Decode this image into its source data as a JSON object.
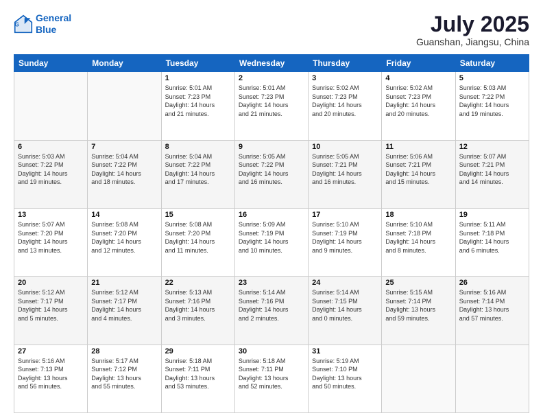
{
  "header": {
    "logo_line1": "General",
    "logo_line2": "Blue",
    "month": "July 2025",
    "location": "Guanshan, Jiangsu, China"
  },
  "weekdays": [
    "Sunday",
    "Monday",
    "Tuesday",
    "Wednesday",
    "Thursday",
    "Friday",
    "Saturday"
  ],
  "weeks": [
    [
      {
        "day": "",
        "info": ""
      },
      {
        "day": "",
        "info": ""
      },
      {
        "day": "1",
        "info": "Sunrise: 5:01 AM\nSunset: 7:23 PM\nDaylight: 14 hours\nand 21 minutes."
      },
      {
        "day": "2",
        "info": "Sunrise: 5:01 AM\nSunset: 7:23 PM\nDaylight: 14 hours\nand 21 minutes."
      },
      {
        "day": "3",
        "info": "Sunrise: 5:02 AM\nSunset: 7:23 PM\nDaylight: 14 hours\nand 20 minutes."
      },
      {
        "day": "4",
        "info": "Sunrise: 5:02 AM\nSunset: 7:23 PM\nDaylight: 14 hours\nand 20 minutes."
      },
      {
        "day": "5",
        "info": "Sunrise: 5:03 AM\nSunset: 7:22 PM\nDaylight: 14 hours\nand 19 minutes."
      }
    ],
    [
      {
        "day": "6",
        "info": "Sunrise: 5:03 AM\nSunset: 7:22 PM\nDaylight: 14 hours\nand 19 minutes."
      },
      {
        "day": "7",
        "info": "Sunrise: 5:04 AM\nSunset: 7:22 PM\nDaylight: 14 hours\nand 18 minutes."
      },
      {
        "day": "8",
        "info": "Sunrise: 5:04 AM\nSunset: 7:22 PM\nDaylight: 14 hours\nand 17 minutes."
      },
      {
        "day": "9",
        "info": "Sunrise: 5:05 AM\nSunset: 7:22 PM\nDaylight: 14 hours\nand 16 minutes."
      },
      {
        "day": "10",
        "info": "Sunrise: 5:05 AM\nSunset: 7:21 PM\nDaylight: 14 hours\nand 16 minutes."
      },
      {
        "day": "11",
        "info": "Sunrise: 5:06 AM\nSunset: 7:21 PM\nDaylight: 14 hours\nand 15 minutes."
      },
      {
        "day": "12",
        "info": "Sunrise: 5:07 AM\nSunset: 7:21 PM\nDaylight: 14 hours\nand 14 minutes."
      }
    ],
    [
      {
        "day": "13",
        "info": "Sunrise: 5:07 AM\nSunset: 7:20 PM\nDaylight: 14 hours\nand 13 minutes."
      },
      {
        "day": "14",
        "info": "Sunrise: 5:08 AM\nSunset: 7:20 PM\nDaylight: 14 hours\nand 12 minutes."
      },
      {
        "day": "15",
        "info": "Sunrise: 5:08 AM\nSunset: 7:20 PM\nDaylight: 14 hours\nand 11 minutes."
      },
      {
        "day": "16",
        "info": "Sunrise: 5:09 AM\nSunset: 7:19 PM\nDaylight: 14 hours\nand 10 minutes."
      },
      {
        "day": "17",
        "info": "Sunrise: 5:10 AM\nSunset: 7:19 PM\nDaylight: 14 hours\nand 9 minutes."
      },
      {
        "day": "18",
        "info": "Sunrise: 5:10 AM\nSunset: 7:18 PM\nDaylight: 14 hours\nand 8 minutes."
      },
      {
        "day": "19",
        "info": "Sunrise: 5:11 AM\nSunset: 7:18 PM\nDaylight: 14 hours\nand 6 minutes."
      }
    ],
    [
      {
        "day": "20",
        "info": "Sunrise: 5:12 AM\nSunset: 7:17 PM\nDaylight: 14 hours\nand 5 minutes."
      },
      {
        "day": "21",
        "info": "Sunrise: 5:12 AM\nSunset: 7:17 PM\nDaylight: 14 hours\nand 4 minutes."
      },
      {
        "day": "22",
        "info": "Sunrise: 5:13 AM\nSunset: 7:16 PM\nDaylight: 14 hours\nand 3 minutes."
      },
      {
        "day": "23",
        "info": "Sunrise: 5:14 AM\nSunset: 7:16 PM\nDaylight: 14 hours\nand 2 minutes."
      },
      {
        "day": "24",
        "info": "Sunrise: 5:14 AM\nSunset: 7:15 PM\nDaylight: 14 hours\nand 0 minutes."
      },
      {
        "day": "25",
        "info": "Sunrise: 5:15 AM\nSunset: 7:14 PM\nDaylight: 13 hours\nand 59 minutes."
      },
      {
        "day": "26",
        "info": "Sunrise: 5:16 AM\nSunset: 7:14 PM\nDaylight: 13 hours\nand 57 minutes."
      }
    ],
    [
      {
        "day": "27",
        "info": "Sunrise: 5:16 AM\nSunset: 7:13 PM\nDaylight: 13 hours\nand 56 minutes."
      },
      {
        "day": "28",
        "info": "Sunrise: 5:17 AM\nSunset: 7:12 PM\nDaylight: 13 hours\nand 55 minutes."
      },
      {
        "day": "29",
        "info": "Sunrise: 5:18 AM\nSunset: 7:11 PM\nDaylight: 13 hours\nand 53 minutes."
      },
      {
        "day": "30",
        "info": "Sunrise: 5:18 AM\nSunset: 7:11 PM\nDaylight: 13 hours\nand 52 minutes."
      },
      {
        "day": "31",
        "info": "Sunrise: 5:19 AM\nSunset: 7:10 PM\nDaylight: 13 hours\nand 50 minutes."
      },
      {
        "day": "",
        "info": ""
      },
      {
        "day": "",
        "info": ""
      }
    ]
  ]
}
